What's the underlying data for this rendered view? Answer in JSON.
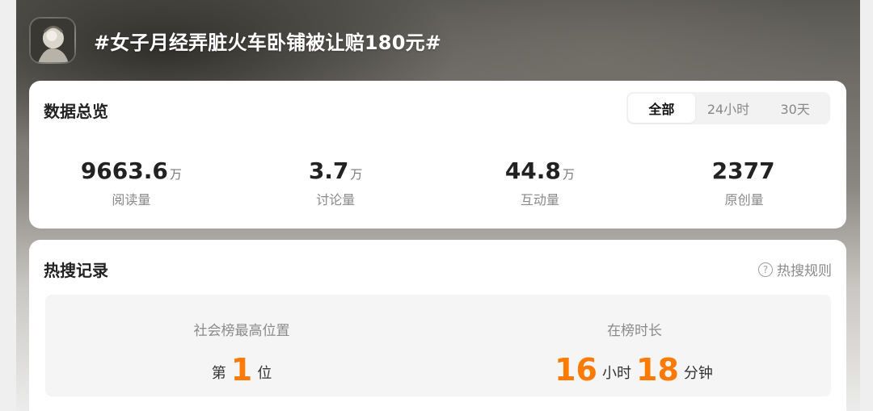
{
  "header": {
    "title": "#女子月经弄脏火车卧铺被让赔180元#",
    "avatar_icon": "topic-avatar-icon"
  },
  "overview": {
    "title": "数据总览",
    "tabs": [
      {
        "label": "全部",
        "active": true
      },
      {
        "label": "24小时",
        "active": false
      },
      {
        "label": "30天",
        "active": false
      }
    ],
    "stats": [
      {
        "value": "9663.6",
        "unit": "万",
        "label": "阅读量"
      },
      {
        "value": "3.7",
        "unit": "万",
        "label": "讨论量"
      },
      {
        "value": "44.8",
        "unit": "万",
        "label": "互动量"
      },
      {
        "value": "2377",
        "unit": "",
        "label": "原创量"
      }
    ]
  },
  "records": {
    "title": "热搜记录",
    "rules_label": "热搜规则",
    "rules_icon": "help-circle-icon",
    "highest_rank": {
      "label": "社会榜最高位置",
      "prefix": "第",
      "value": "1",
      "suffix": "位"
    },
    "duration": {
      "label": "在榜时长",
      "hours": "16",
      "hours_unit": "小时",
      "minutes": "18",
      "minutes_unit": "分钟"
    }
  },
  "colors": {
    "accent_orange": "#ff7a00",
    "text_primary": "#222222",
    "text_secondary": "#8a8a8a"
  }
}
